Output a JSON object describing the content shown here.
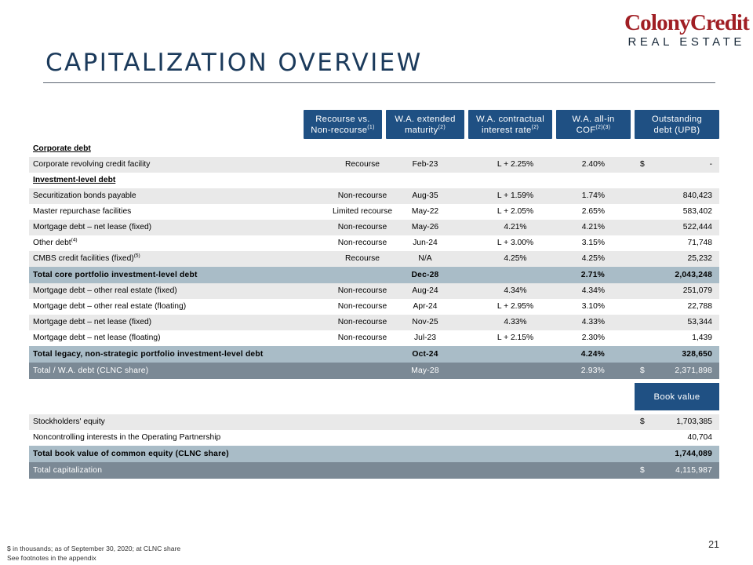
{
  "logo": {
    "line1": "ColonyCredit",
    "line2": "REAL ESTATE"
  },
  "title": "CAPITALIZATION OVERVIEW",
  "headers": {
    "recourse": {
      "l1": "Recourse vs.",
      "l2": "Non-recourse",
      "sup": "(1)"
    },
    "maturity": {
      "l1": "W.A. extended",
      "l2": "maturity",
      "sup": "(2)"
    },
    "interest": {
      "l1": "W.A. contractual",
      "l2": "interest rate",
      "sup": "(2)"
    },
    "cof": {
      "l1": "W.A. all-in",
      "l2": "COF",
      "sup": "(2)(3)"
    },
    "outstanding": {
      "l1": "Outstanding",
      "l2": "debt (UPB)"
    }
  },
  "sections": {
    "corporate": "Corporate debt",
    "investment": "Investment-level debt"
  },
  "rows": {
    "corp_rcf": {
      "label": "Corporate revolving credit facility",
      "recourse": "Recourse",
      "maturity": "Feb-23",
      "interest": "L + 2.25%",
      "cof": "2.40%",
      "dollar": "$",
      "amount": "-"
    },
    "sec_bonds": {
      "label": "Securitization bonds payable",
      "recourse": "Non-recourse",
      "maturity": "Aug-35",
      "interest": "L + 1.59%",
      "cof": "1.74%",
      "amount": "840,423"
    },
    "master_repo": {
      "label": "Master repurchase facilities",
      "recourse": "Limited recourse",
      "maturity": "May-22",
      "interest": "L + 2.05%",
      "cof": "2.65%",
      "amount": "583,402"
    },
    "mort_nl_fixed": {
      "label": "Mortgage debt – net lease (fixed)",
      "recourse": "Non-recourse",
      "maturity": "May-26",
      "interest": "4.21%",
      "cof": "4.21%",
      "amount": "522,444"
    },
    "other_debt": {
      "label": "Other debt",
      "sup": "(4)",
      "recourse": "Non-recourse",
      "maturity": "Jun-24",
      "interest": "L + 3.00%",
      "cof": "3.15%",
      "amount": "71,748"
    },
    "cmbs": {
      "label": "CMBS credit facilities (fixed)",
      "sup": "(5)",
      "recourse": "Recourse",
      "maturity": "N/A",
      "interest": "4.25%",
      "cof": "4.25%",
      "amount": "25,232"
    },
    "core_total": {
      "label": "Total core portfolio investment-level debt",
      "maturity": "Dec-28",
      "cof": "2.71%",
      "amount": "2,043,248"
    },
    "mort_ore_fixed": {
      "label": "Mortgage debt – other real estate (fixed)",
      "recourse": "Non-recourse",
      "maturity": "Aug-24",
      "interest": "4.34%",
      "cof": "4.34%",
      "amount": "251,079"
    },
    "mort_ore_float": {
      "label": "Mortgage debt – other real estate (floating)",
      "recourse": "Non-recourse",
      "maturity": "Apr-24",
      "interest": "L + 2.95%",
      "cof": "3.10%",
      "amount": "22,788"
    },
    "mort_nl_fixed2": {
      "label": "Mortgage debt – net lease (fixed)",
      "recourse": "Non-recourse",
      "maturity": "Nov-25",
      "interest": "4.33%",
      "cof": "4.33%",
      "amount": "53,344"
    },
    "mort_nl_float": {
      "label": "Mortgage debt – net lease (floating)",
      "recourse": "Non-recourse",
      "maturity": "Jul-23",
      "interest": "L + 2.15%",
      "cof": "2.30%",
      "amount": "1,439"
    },
    "legacy_total": {
      "label": "Total legacy, non-strategic portfolio investment-level debt",
      "maturity": "Oct-24",
      "cof": "4.24%",
      "amount": "328,650"
    },
    "grand_total": {
      "label": "Total / W.A. debt (CLNC share)",
      "maturity": "May-28",
      "cof": "2.93%",
      "dollar": "$",
      "amount": "2,371,898"
    }
  },
  "book_value": {
    "header": "Book value",
    "equity": {
      "label": "Stockholders' equity",
      "dollar": "$",
      "amount": "1,703,385"
    },
    "nci": {
      "label": "Noncontrolling interests in the Operating Partnership",
      "amount": "40,704"
    },
    "total_equity": {
      "label": "Total book value of common equity (CLNC share)",
      "amount": "1,744,089"
    },
    "total_cap": {
      "label": "Total capitalization",
      "dollar": "$",
      "amount": "4,115,987"
    }
  },
  "footer": {
    "note1": "$ in thousands; as of September 30, 2020; at CLNC share",
    "note2": "See footnotes in the appendix"
  },
  "page_number": "21",
  "colors": {
    "header_blue": "#1f5083",
    "subtotal": "#a9bcc7",
    "total": "#7b8995",
    "shade": "#e9e9e9",
    "logo_red": "#a01e24",
    "title": "#1b3a5b"
  }
}
